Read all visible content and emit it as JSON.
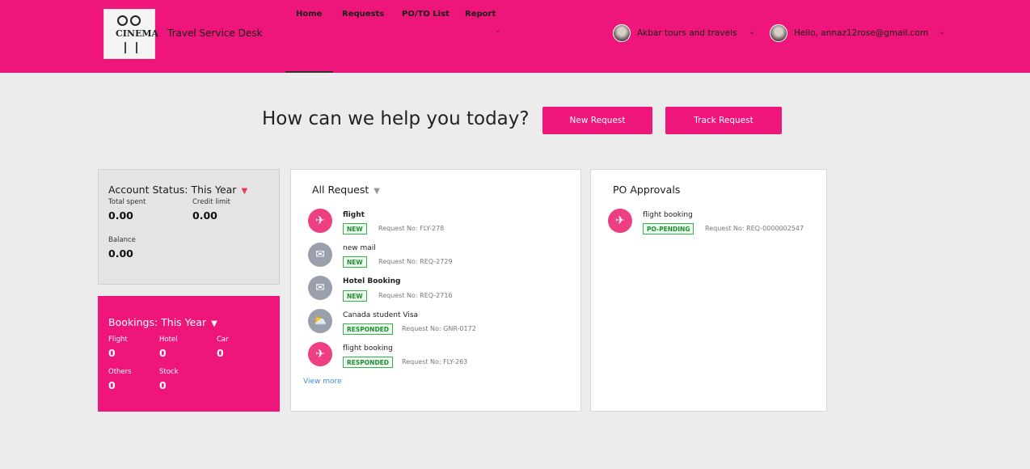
{
  "header": {
    "logo_text": "CINEMA",
    "app_title": "Travel Service Desk",
    "nav": [
      "Home",
      "Requests",
      "PO/TO List",
      "Report"
    ],
    "nav_caret": "⌄",
    "company": "Akbar tours and travels",
    "user_greeting": "Hello, annaz12rose@gmail.com",
    "dropdown_icon": "⌄"
  },
  "hero": {
    "question": "How can we help you today?",
    "new_request_label": "New Request",
    "track_request_label": "Track Request"
  },
  "account": {
    "title": "Account Status: This Year",
    "total_spent_label": "Total spent",
    "total_spent": "0.00",
    "credit_limit_label": "Credit limit",
    "credit_limit": "0.00",
    "balance_label": "Balance",
    "balance": "0.00"
  },
  "bookings": {
    "title": "Bookings: This Year",
    "items": [
      {
        "label": "Flight",
        "value": "0"
      },
      {
        "label": "Hotel",
        "value": "0"
      },
      {
        "label": "Car",
        "value": "0"
      },
      {
        "label": "Others",
        "value": "0"
      },
      {
        "label": "Stock",
        "value": "0"
      }
    ]
  },
  "all_requests": {
    "title": "All Request",
    "items": [
      {
        "icon": "plane-icon",
        "title": "flight",
        "status": "NEW",
        "req_no": "Request No: FLY-278"
      },
      {
        "icon": "mail-icon",
        "title": "new mail",
        "status": "NEW",
        "req_no": "Request No: REQ-2729"
      },
      {
        "icon": "mail-icon",
        "title": "Hotel Booking",
        "status": "NEW",
        "req_no": "Request No: REQ-2716"
      },
      {
        "icon": "weather-icon",
        "title": "Canada student Visa",
        "status": "RESPONDED",
        "req_no": "Request No: GNR-0172"
      },
      {
        "icon": "plane-icon",
        "title": "flight booking",
        "status": "RESPONDED",
        "req_no": "Request No: FLY-263"
      }
    ],
    "view_more": "View more"
  },
  "po_approvals": {
    "title": "PO Approvals",
    "items": [
      {
        "icon": "plane-icon",
        "title": "flight booking",
        "status": "PO-PENDING",
        "req_no": "Request No: REQ-0000002547"
      }
    ]
  },
  "colors": {
    "brand": "#ee167a",
    "badge_green": "#34b34a",
    "link": "#3d8fd6"
  }
}
